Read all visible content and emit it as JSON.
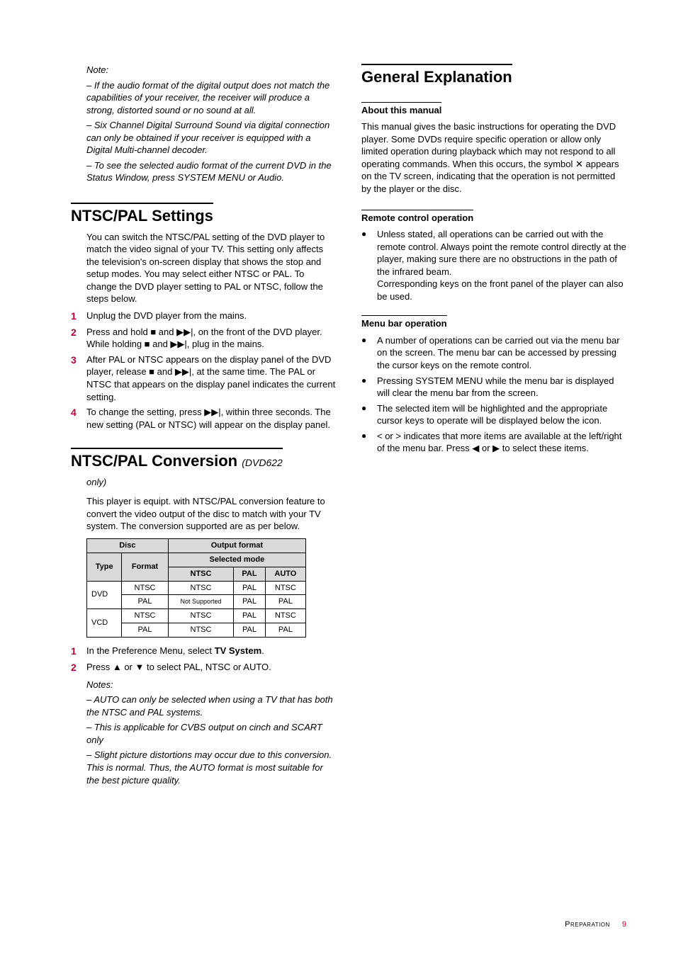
{
  "left": {
    "note_heading": "Note:",
    "note_lines": [
      "–   If the audio format of the digital output does not match the capabilities of your receiver, the receiver will produce a strong, distorted sound or no sound at all.",
      "–   Six Channel Digital Surround Sound via digital connection can only be obtained if your receiver is equipped with a Digital Multi-channel decoder.",
      "–   To see the selected audio format of the current DVD in the Status Window, press SYSTEM MENU or Audio."
    ],
    "ntsc_settings": {
      "title": "NTSC/PAL Settings",
      "intro": "You can switch the NTSC/PAL setting of the DVD player to match the video signal of your TV. This setting only affects the television's on-screen display that shows the stop and setup modes. You may select either NTSC or PAL. To change the DVD player setting to PAL or NTSC, follow the steps below.",
      "steps": [
        "Unplug the DVD player from the mains.",
        "Press and hold ■ and ▶▶|, on the front of the DVD player. While holding ■ and ▶▶|, plug in the mains.",
        "After PAL or NTSC appears on the display panel of the DVD player, release ■ and ▶▶|,  at the same time. The PAL or NTSC that appears on the display panel indicates the current setting.",
        "To change the setting, press ▶▶|, within three seconds. The new setting (PAL or NTSC) will appear on the display panel."
      ]
    },
    "ntsc_conv": {
      "title_a": "NTSC/PAL Conversion",
      "title_b": "(DVD622",
      "only": "only)",
      "intro": "This player is equipt. with NTSC/PAL conversion feature to convert the video output of the disc to match with your TV system. The conversion supported are as per below.",
      "table": {
        "h_disc": "Disc",
        "h_out": "Output format",
        "h_type": "Type",
        "h_format": "Format",
        "h_sel": "Selected mode",
        "h_ntsc": "NTSC",
        "h_pal": "PAL",
        "h_auto": "AUTO",
        "rows": [
          {
            "type": "DVD",
            "format": "NTSC",
            "ntsc": "NTSC",
            "pal": "PAL",
            "auto": "NTSC"
          },
          {
            "type": "",
            "format": "PAL",
            "ntsc": "Not Supported",
            "pal": "PAL",
            "auto": "PAL"
          },
          {
            "type": "VCD",
            "format": "NTSC",
            "ntsc": "NTSC",
            "pal": "PAL",
            "auto": "NTSC"
          },
          {
            "type": "",
            "format": "PAL",
            "ntsc": "NTSC",
            "pal": "PAL",
            "auto": "PAL"
          }
        ]
      },
      "steps": [
        {
          "pre": "In the Preference Menu, select ",
          "bold": "TV System",
          "post": "."
        },
        {
          "pre": "Press ▲ or ▼ to select PAL, NTSC or AUTO.",
          "bold": "",
          "post": ""
        }
      ],
      "notes_heading": "Notes:",
      "notes": [
        "–   AUTO can only be selected when using a TV that has both the NTSC and PAL systems.",
        "–   This is applicable for CVBS output on cinch and SCART only",
        "–   Slight picture distortions may occur due to this conversion. This is normal. Thus, the AUTO format is most suitable for the best picture quality."
      ]
    }
  },
  "right": {
    "gen_title": "General Explanation",
    "about": {
      "title": "About this manual",
      "body_a": "This manual gives the basic instructions for operating the DVD player. Some DVDs require specific operation or allow only limited operation during playback which may not respond to all operating commands. When this occurs, the symbol ",
      "body_b": " appears on the TV screen, indicating that the operation is not permitted by the player or the disc."
    },
    "remote": {
      "title": "Remote control operation",
      "bullet_a": "Unless stated, all operations can be carried out with the remote control. Always point the remote control directly at the player, making sure there are no obstructions in the path of the infrared beam.",
      "bullet_b": "Corresponding keys on the front panel of the player can also be used."
    },
    "menubar": {
      "title": "Menu bar operation",
      "bullets": [
        "A number of operations can be carried out via the menu bar on the screen. The menu bar can be accessed by pressing the cursor keys on the remote control.",
        "Pressing SYSTEM MENU while the menu bar is displayed will clear the menu bar from the screen.",
        "The selected item will be highlighted and the appropriate cursor keys to operate will be displayed below the icon.",
        "< or > indicates that more items are available at the left/right of the menu bar. Press ◀ or ▶ to select these items."
      ]
    }
  },
  "footer": {
    "label": "Preparation",
    "page": "9"
  }
}
